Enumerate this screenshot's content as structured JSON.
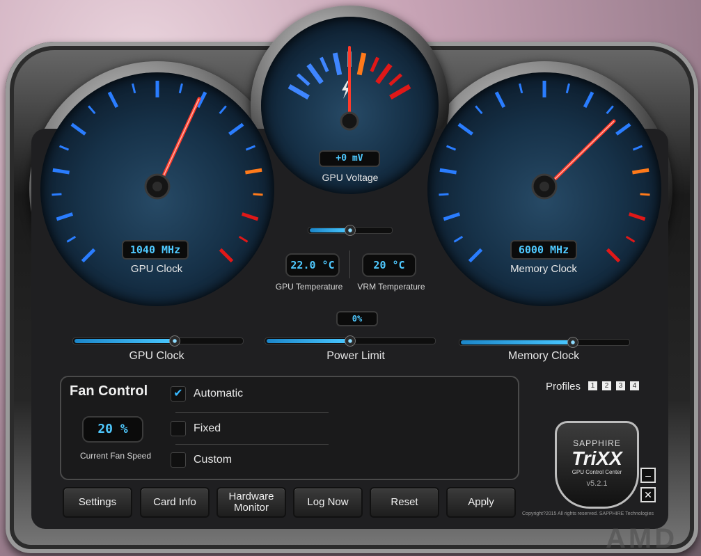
{
  "gauges": {
    "gpu_clock": {
      "readout": "1040 MHz",
      "label": "GPU Clock"
    },
    "gpu_voltage": {
      "readout": "+0 mV",
      "label": "GPU Voltage"
    },
    "memory_clock": {
      "readout": "6000 MHz",
      "label": "Memory Clock"
    }
  },
  "temps": {
    "gpu": {
      "value": "22.0 °C",
      "label": "GPU Temperature"
    },
    "vrm": {
      "value": "20 °C",
      "label": "VRM Temperature"
    }
  },
  "power_limit_readout": "0%",
  "sliders": {
    "voltage": {
      "level": 0.5
    },
    "gpu_clock": {
      "label": "GPU Clock",
      "level": 0.6
    },
    "power_limit": {
      "label": "Power Limit",
      "level": 0.5
    },
    "memory_clock": {
      "label": "Memory Clock",
      "level": 0.67
    }
  },
  "fan_control": {
    "title": "Fan Control",
    "current_speed": "20 %",
    "current_speed_label": "Current Fan Speed",
    "options": [
      {
        "label": "Automatic",
        "checked": true
      },
      {
        "label": "Fixed",
        "checked": false
      },
      {
        "label": "Custom",
        "checked": false
      }
    ]
  },
  "profiles": {
    "label": "Profiles",
    "slots": [
      "1",
      "2",
      "3",
      "4"
    ]
  },
  "buttons": {
    "settings": "Settings",
    "card_info": "Card Info",
    "hardware_monitor": "Hardware Monitor",
    "log_now": "Log Now",
    "reset": "Reset",
    "apply": "Apply"
  },
  "logo": {
    "brand": "SAPPHIRE",
    "product": "TriXX",
    "tagline": "GPU Control Center",
    "version": "v5.2.1"
  },
  "copyright": "Copyright?2015 All rights reserved. SAPPHIRE Technologies",
  "watermark": "AMD",
  "window_controls": {
    "minimize": "–",
    "close": "✕"
  },
  "colors": {
    "accent": "#4fc9ff",
    "scale_blue": "#2a7dff",
    "scale_orange": "#ff7a1a",
    "scale_red": "#e01818"
  }
}
